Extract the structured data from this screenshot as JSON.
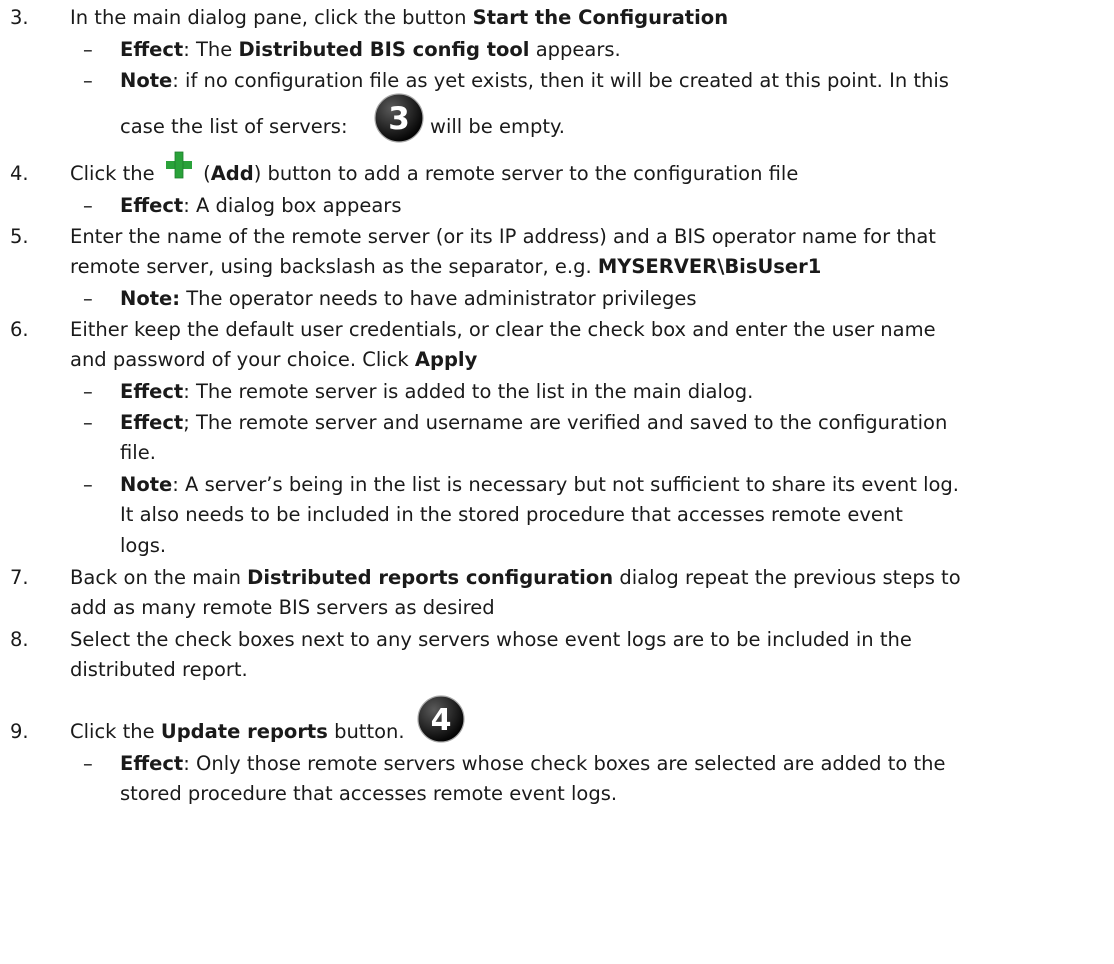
{
  "badges": {
    "three": "3",
    "four": "4"
  },
  "colors": {
    "plus_icon": "#2aa23a",
    "badge": "#111111",
    "text": "#1a1a1a"
  },
  "steps": [
    {
      "number": "3.",
      "parts": [
        "In the main dialog pane, click the button ",
        "Start the Configuration"
      ],
      "bullets": [
        {
          "dash": "–",
          "bold": "Effect",
          "rest": ": The ",
          "bold2": "Distributed BIS config tool",
          "rest2": " appears."
        },
        {
          "dash": "–",
          "bold": "Note",
          "rest": ": if no configuration file as yet exists, then it will be created at this point. In this",
          "cont_a": "case the list of servers: ",
          "cont_b": " will be empty."
        }
      ]
    },
    {
      "number": "4.",
      "parts": [
        "Click the ",
        " (",
        "Add",
        ") button to add a remote server to the configuration file"
      ],
      "bullets": [
        {
          "dash": "–",
          "bold": "Effect",
          "rest": ": A dialog box appears"
        }
      ]
    },
    {
      "number": "5.",
      "line1": "Enter the name of the remote server (or its IP address) and a BIS operator name for that",
      "line2": "remote server, using backslash as the separator, e.g. ",
      "line2_bold": "MYSERVER\\BisUser1",
      "bullets": [
        {
          "dash": "–",
          "bold": "Note:",
          "rest": " The operator needs to have administrator privileges"
        }
      ]
    },
    {
      "number": "6.",
      "line1": "Either keep the default user credentials, or clear the check box and enter the user name",
      "line2": "and password of your choice. Click ",
      "line2_bold": "Apply",
      "bullets": [
        {
          "dash": "–",
          "bold": "Effect",
          "rest": ": The remote server is added to the list in the main dialog."
        },
        {
          "dash": "–",
          "bold": "Effect",
          "rest": "; The remote server and username are verified and saved to the configuration",
          "cont": "file."
        },
        {
          "dash": "–",
          "bold": "Note",
          "rest": ": A server’s being in the list is necessary but not sufficient to share its event log.",
          "cont": "It also needs to be included in the stored procedure that accesses remote event",
          "cont2": "logs."
        }
      ]
    },
    {
      "number": "7.",
      "line1_a": "Back on the main ",
      "line1_bold": "Distributed reports configuration",
      "line1_b": " dialog repeat the previous steps to",
      "line2": "add as many remote BIS servers as desired"
    },
    {
      "number": "8.",
      "line1": "Select the check boxes next to any servers whose event logs are to be included in the",
      "line2": "distributed report."
    },
    {
      "number": "9.",
      "parts": [
        "Click the ",
        "Update reports",
        " button. "
      ],
      "bullets": [
        {
          "dash": "–",
          "bold": "Effect",
          "rest": ": Only those remote servers whose check boxes are selected are added to the",
          "cont": "stored procedure that accesses remote event logs."
        }
      ]
    }
  ]
}
